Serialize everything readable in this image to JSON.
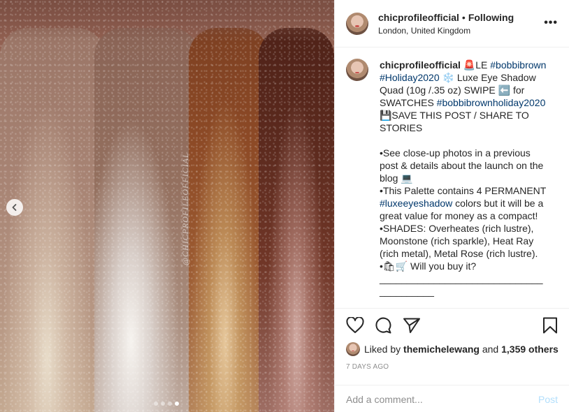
{
  "photo": {
    "watermark": "@CHICPROFILEOFFICIAL",
    "carousel_total": 4,
    "carousel_active": 4
  },
  "header": {
    "username": "chicprofileofficial",
    "separator": "•",
    "follow_status": "Following",
    "location": "London, United Kingdom",
    "more_label": "•••"
  },
  "caption": {
    "username": "chicprofileofficial",
    "segments": [
      {
        "t": " 🚨LE ",
        "tag": false
      },
      {
        "t": "#bobbibrown",
        "tag": true
      },
      {
        "t": " ",
        "tag": false
      },
      {
        "t": "#Holiday2020",
        "tag": true
      },
      {
        "t": " ❄️ Luxe Eye Shadow Quad (10g /.35 oz) SWIPE ⬅️ for SWATCHES ",
        "tag": false
      },
      {
        "t": "#bobbibrownholiday2020",
        "tag": true
      },
      {
        "t": "\n💾SAVE THIS POST / SHARE TO STORIES\n\n•See close-up photos in a previous post & details about the launch on the blog 💻\n•This Palette contains 4 PERMANENT ",
        "tag": false
      },
      {
        "t": "#luxeeyeshadow",
        "tag": true
      },
      {
        "t": " colors but it will be a great value for money as a compact!\n•SHADES: Overheates (rich lustre), Moonstone (rich sparkle), Heat Ray (rich metal), Metal Rose (rich lustre).\n•🛍🛒 Will you buy it?\n________________________________________",
        "tag": false
      }
    ]
  },
  "actions": {
    "liked_by_prefix": "Liked by",
    "liked_by_user": "themichelewang",
    "and_text": "and",
    "others_text": "1,359 others",
    "date": "7 DAYS AGO",
    "comment_placeholder": "Add a comment...",
    "post_label": "Post"
  }
}
